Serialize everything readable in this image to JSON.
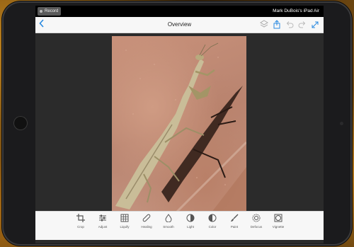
{
  "status_bar": {
    "record_label": "Record",
    "device_name": "Mark DuBois's iPad Air"
  },
  "nav": {
    "back_icon": "chevron-left-icon",
    "title": "Overview",
    "right_icons": [
      "layers-icon",
      "share-icon",
      "undo-icon",
      "redo-icon",
      "expand-icon"
    ]
  },
  "photo": {
    "description_icon": "praying-mantis-photo"
  },
  "toolbar": {
    "tools": [
      {
        "label": "Crop",
        "icon": "crop-icon"
      },
      {
        "label": "Adjust",
        "icon": "sliders-icon"
      },
      {
        "label": "Liquify",
        "icon": "grid-icon"
      },
      {
        "label": "Healing",
        "icon": "bandage-icon"
      },
      {
        "label": "Smooth",
        "icon": "drop-icon"
      },
      {
        "label": "Light",
        "icon": "half-circle-icon"
      },
      {
        "label": "Color",
        "icon": "color-circle-icon"
      },
      {
        "label": "Paint",
        "icon": "brush-icon"
      },
      {
        "label": "Defocus",
        "icon": "defocus-icon"
      },
      {
        "label": "Vignette",
        "icon": "vignette-icon"
      }
    ]
  },
  "colors": {
    "accent": "#2a8ae0",
    "toolbar_bg": "#f7f7f7",
    "canvas_bg": "#2b2b2b"
  }
}
